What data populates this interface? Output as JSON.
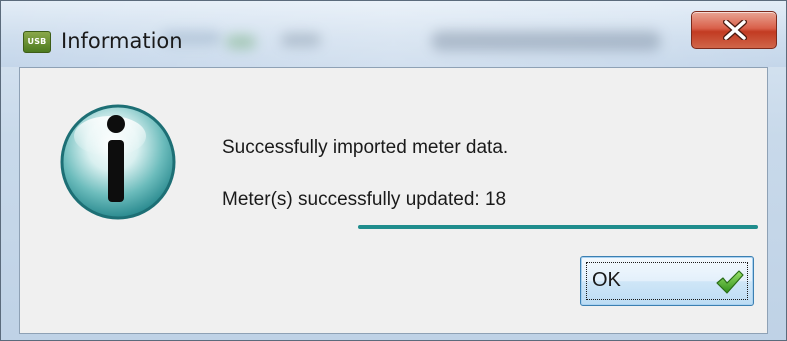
{
  "window": {
    "title": "Information",
    "app_icon_text": "USB",
    "app_icon": "usb-app-icon",
    "close_icon": "close-x-icon"
  },
  "message": {
    "icon": "info-icon",
    "line1": "Successfully imported meter data.",
    "line2": "Meter(s) successfully updated: 18"
  },
  "progress": {
    "fraction": 1.0,
    "color": "#1f8d8d"
  },
  "buttons": {
    "ok_label": "OK",
    "ok_icon": "green-check-icon"
  },
  "colors": {
    "accent_teal": "#1f8d8d",
    "close_red": "#c23b22",
    "check_green": "#4caf2a"
  }
}
